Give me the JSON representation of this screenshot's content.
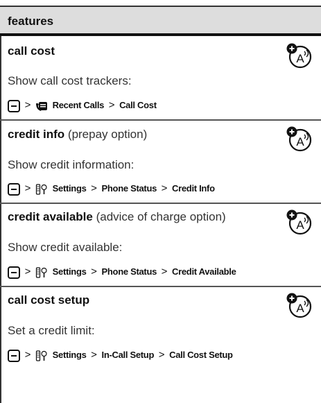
{
  "header": {
    "title": "features"
  },
  "sections": [
    {
      "title": "call cost",
      "title_note": "",
      "description": "Show call cost trackers:",
      "path": [
        "Recent Calls",
        "Call Cost"
      ],
      "path_icon": "recent-calls-icon"
    },
    {
      "title": "credit info",
      "title_note": "(prepay option)",
      "description": "Show credit information:",
      "path": [
        "Settings",
        "Phone Status",
        "Credit Info"
      ],
      "path_icon": "settings-icon"
    },
    {
      "title": "credit available",
      "title_note": "(advice of charge option)",
      "description": "Show credit available:",
      "path": [
        "Settings",
        "Phone Status",
        "Credit Available"
      ],
      "path_icon": "settings-icon"
    },
    {
      "title": "call cost setup",
      "title_note": "",
      "description": "Set a credit limit:",
      "path": [
        "Settings",
        "In-Call Setup",
        "Call Cost Setup"
      ],
      "path_icon": "settings-icon"
    }
  ],
  "separator": ">",
  "indicator_icon": "network-dependent-feature-icon"
}
